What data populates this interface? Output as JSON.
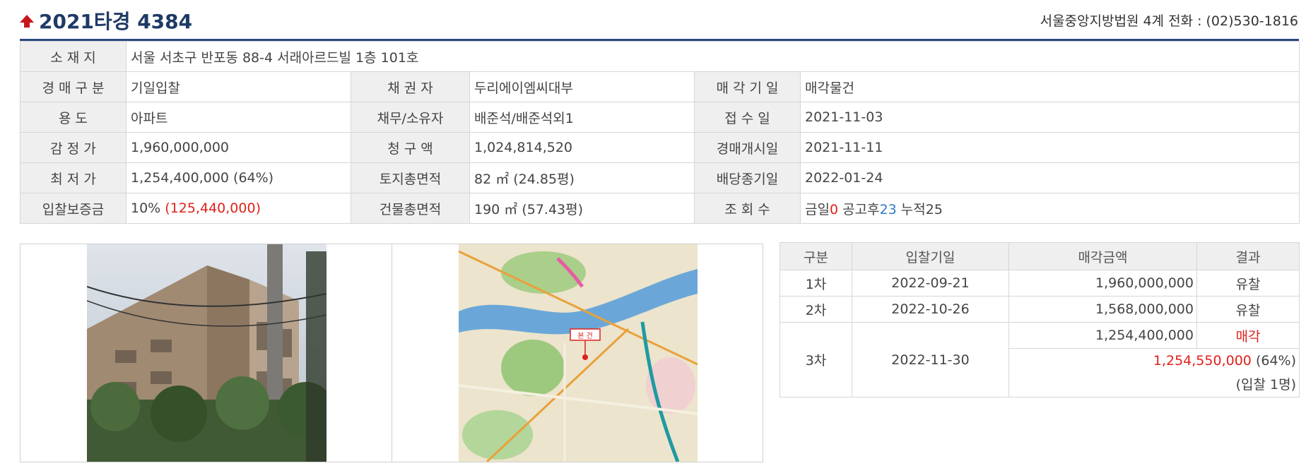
{
  "header": {
    "case_number": "2021타경 4384",
    "court_info": "서울중앙지방법원 4계 전화 : (02)530-1816"
  },
  "colors": {
    "accent_red": "#e0201b",
    "accent_blue": "#2e7bc4",
    "title_navy": "#1e3a66"
  },
  "info": {
    "location_label": "소 재 지",
    "location_value": "서울 서초구 반포동 88-4 서래아르드빌 1층 101호",
    "auction_type_label": "경 매 구 분",
    "auction_type_value": "기일입찰",
    "creditor_label": "채 권 자",
    "creditor_value": "두리에이엠씨대부",
    "sale_date_label": "매 각 기 일",
    "sale_date_value": "매각물건",
    "usage_label": "용 도",
    "usage_value": "아파트",
    "debtor_label": "채무/소유자",
    "debtor_value": "배준석/배준석외1",
    "receipt_label": "접 수 일",
    "receipt_value": "2021-11-03",
    "appraisal_label": "감 정 가",
    "appraisal_value": "1,960,000,000",
    "claim_label": "청 구 액",
    "claim_value": "1,024,814,520",
    "start_label": "경매개시일",
    "start_value": "2021-11-11",
    "min_price_label": "최 저 가",
    "min_price_value": "1,254,400,000 (64%)",
    "land_area_label": "토지총면적",
    "land_area_value": "82 ㎡ (24.85평)",
    "dividend_label": "배당종기일",
    "dividend_value": "2022-01-24",
    "deposit_label": "입찰보증금",
    "deposit_pct": "10%",
    "deposit_amount": "(125,440,000)",
    "building_area_label": "건물총면적",
    "building_area_value": "190 ㎡ (57.43평)",
    "views_label": "조 회 수",
    "views_today_label": "금일",
    "views_today": "0",
    "views_after_label": "공고후",
    "views_after": "23",
    "views_total_label": "누적",
    "views_total": "25"
  },
  "map_labels": {
    "marker": "본 건"
  },
  "bids": {
    "headers": [
      "구분",
      "입찰기일",
      "매각금액",
      "결과"
    ],
    "rows": [
      {
        "round": "1차",
        "date": "2022-09-21",
        "amount": "1,960,000,000",
        "result": "유찰"
      },
      {
        "round": "2차",
        "date": "2022-10-26",
        "amount": "1,568,000,000",
        "result": "유찰"
      },
      {
        "round": "3차",
        "date": "2022-11-30",
        "amount": "1,254,400,000",
        "result": "매각",
        "sold_amount": "1,254,550,000",
        "sold_pct": "(64%)",
        "bidders": "(입찰 1명)"
      }
    ]
  }
}
